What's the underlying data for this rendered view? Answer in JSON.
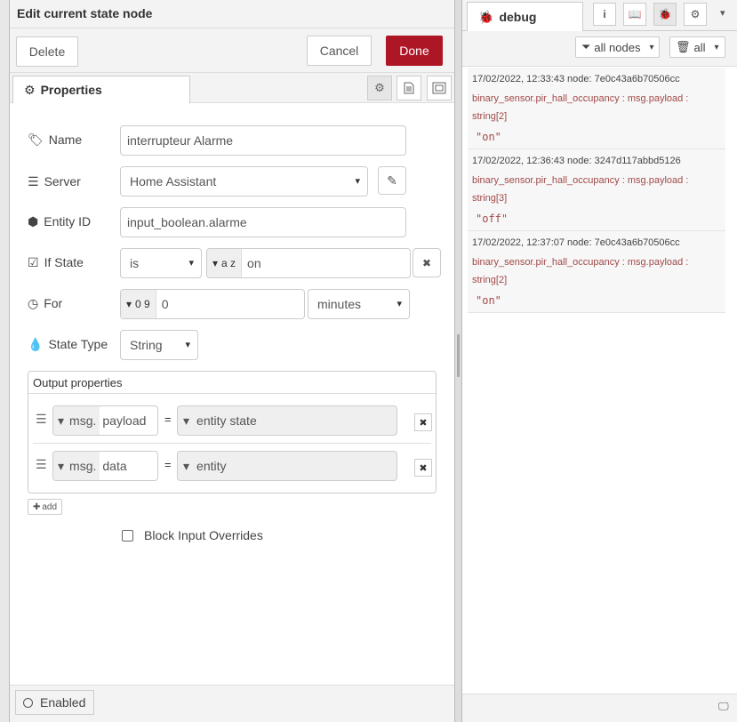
{
  "editor": {
    "title": "Edit current state node",
    "delete_label": "Delete",
    "cancel_label": "Cancel",
    "done_label": "Done",
    "tab_properties": "Properties"
  },
  "fields": {
    "name_label": "Name",
    "name_value": "interrupteur Alarme",
    "server_label": "Server",
    "server_value": "Home Assistant",
    "entity_label": "Entity ID",
    "entity_value": "input_boolean.alarme",
    "ifstate_label": "If State",
    "ifstate_op": "is",
    "ifstate_type": "a z",
    "ifstate_value": "on",
    "for_label": "For",
    "for_type": "0 9",
    "for_value": "0",
    "for_unit": "minutes",
    "statetype_label": "State Type",
    "statetype_value": "String"
  },
  "output": {
    "title": "Output properties",
    "rows": [
      {
        "prefix": "msg.",
        "property": "payload",
        "value": "entity state"
      },
      {
        "prefix": "msg.",
        "property": "data",
        "value": "entity"
      }
    ],
    "add_label": "add"
  },
  "block_label": "Block Input Overrides",
  "enabled_label": "Enabled",
  "sidebar": {
    "tab_label": "debug",
    "filter_label": "all nodes",
    "clear_label": "all",
    "messages": [
      {
        "meta": "17/02/2022, 12:33:43   node: 7e0c43a6b70506cc",
        "topic": "binary_sensor.pir_hall_occupancy : msg.payload : string[2]",
        "value": "\"on\""
      },
      {
        "meta": "17/02/2022, 12:36:43   node: 3247d117abbd5126",
        "topic": "binary_sensor.pir_hall_occupancy : msg.payload : string[3]",
        "value": "\"off\""
      },
      {
        "meta": "17/02/2022, 12:37:07   node: 7e0c43a6b70506cc",
        "topic": "binary_sensor.pir_hall_occupancy : msg.payload : string[2]",
        "value": "\"on\""
      }
    ]
  }
}
